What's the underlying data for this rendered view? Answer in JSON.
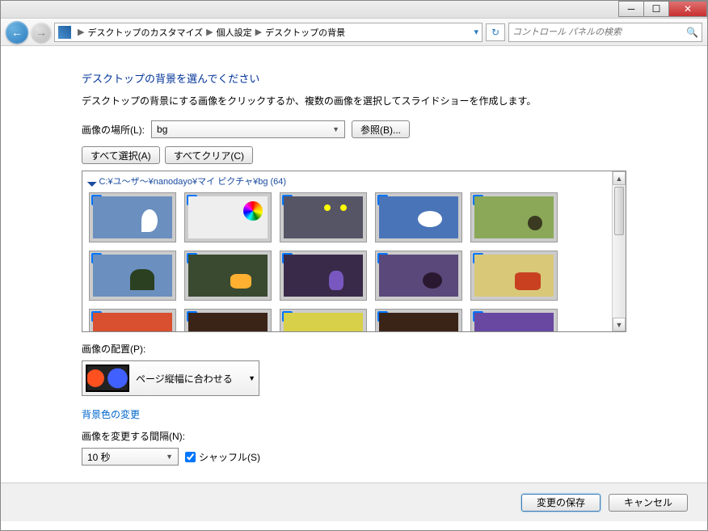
{
  "window": {
    "minimize": "─",
    "maximize": "☐",
    "close": "✕"
  },
  "nav": {
    "back": "←",
    "forward": "→",
    "breadcrumb": {
      "item1": "デスクトップのカスタマイズ",
      "item2": "個人設定",
      "item3": "デスクトップの背景",
      "sep": "▶"
    },
    "refresh": "↻",
    "search_placeholder": "コントロール パネルの検索"
  },
  "main": {
    "title": "デスクトップの背景を選んでください",
    "desc": "デスクトップの背景にする画像をクリックするか、複数の画像を選択してスライドショーを作成します。",
    "location_label": "画像の場所(L):",
    "location_value": "bg",
    "browse": "参照(B)...",
    "select_all": "すべて選択(A)",
    "clear_all": "すべてクリア(C)",
    "gallery_path": "C:¥ユ～ザ～¥nanodayo¥マイ ピクチャ¥bg (64)",
    "triangle": "◢",
    "position_label": "画像の配置(P):",
    "position_value": "ページ縦幅に合わせる",
    "bg_color_link": "背景色の変更",
    "interval_label": "画像を変更する間隔(N):",
    "interval_value": "10 秒",
    "shuffle_label": "シャッフル(S)"
  },
  "footer": {
    "save": "変更の保存",
    "cancel": "キャンセル"
  }
}
